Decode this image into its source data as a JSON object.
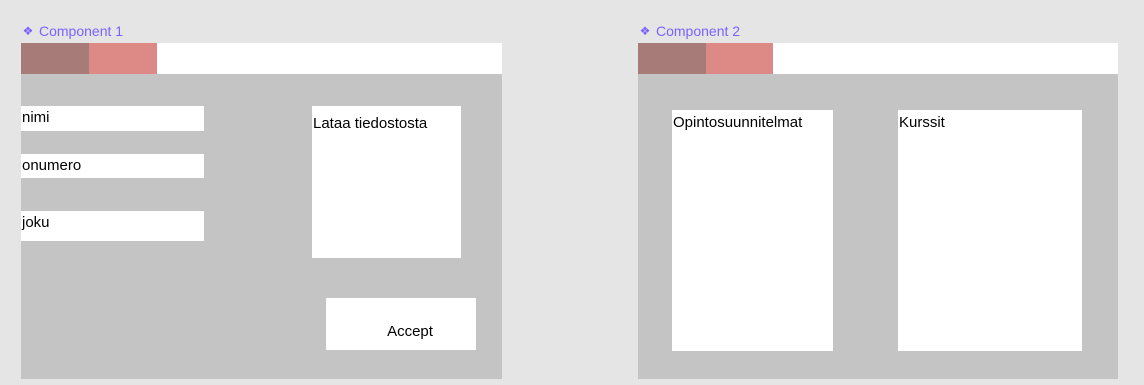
{
  "components": [
    {
      "label": "Component 1",
      "icon": "component-icon",
      "fields": [
        {
          "label": "nimi"
        },
        {
          "label": "onumero"
        },
        {
          "label": "joku"
        }
      ],
      "upload_label": "Lataa tiedostosta",
      "accept_label": "Accept"
    },
    {
      "label": "Component 2",
      "icon": "component-icon",
      "panels": [
        {
          "label": "Opintosuunnitelmat"
        },
        {
          "label": "Kurssit"
        }
      ]
    }
  ],
  "colors": {
    "canvas": "#e5e5e5",
    "frame": "#c4c4c4",
    "label": "#7b61ff",
    "tab_dark": "#a67b78",
    "tab_light": "#dd8a87",
    "box": "#ffffff"
  }
}
